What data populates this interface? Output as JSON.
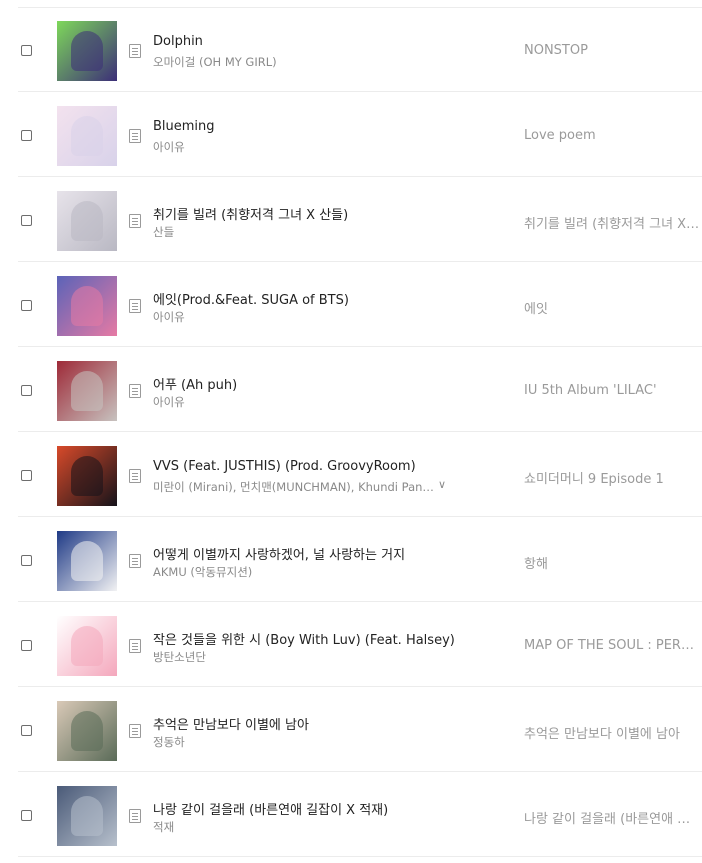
{
  "songs": [
    {
      "title": "Dolphin",
      "artist": "오마이걸 (OH MY GIRL)",
      "album": "NONSTOP",
      "cover_colors": [
        "#3c2e78",
        "#7ed85a"
      ],
      "cover_icon": "album-cover-image"
    },
    {
      "title": "Blueming",
      "artist": "아이유",
      "album": "Love poem",
      "cover_colors": [
        "#d8d2ea",
        "#f3e2ee"
      ],
      "cover_icon": "album-cover-image"
    },
    {
      "title": "취기를 빌려 (취향저격 그녀 X 산들)",
      "artist": "산들",
      "album": "취기를 빌려 (취향저격 그녀 X 산들)",
      "cover_colors": [
        "#b9b8c3",
        "#e7e3ea"
      ],
      "cover_icon": "album-cover-image"
    },
    {
      "title": "에잇(Prod.&Feat. SUGA of BTS)",
      "artist": "아이유",
      "album": "에잇",
      "cover_colors": [
        "#e67aa4",
        "#5b63b8"
      ],
      "cover_icon": "album-cover-image"
    },
    {
      "title": "어푸 (Ah puh)",
      "artist": "아이유",
      "album": "IU 5th Album 'LILAC'",
      "cover_colors": [
        "#c7c2bf",
        "#9e2a38"
      ],
      "cover_icon": "album-cover-image"
    },
    {
      "title": "VVS (Feat. JUSTHIS) (Prod. GroovyRoom)",
      "artist": "미란이 (Mirani), 먼치맨(MUNCHMAN), Khundi Panda, 머쉬베놈 (MUSHVENOM)",
      "album": "쇼미더머니 9 Episode 1",
      "cover_colors": [
        "#15131a",
        "#d84a2a"
      ],
      "cover_icon": "album-cover-image",
      "has_more_artists": true,
      "more_icon": "chevron-down-icon"
    },
    {
      "title": "어떻게 이별까지 사랑하겠어, 널 사랑하는 거지",
      "artist": "AKMU (악동뮤지션)",
      "album": "항해",
      "cover_colors": [
        "#f2f2f3",
        "#1f3a86"
      ],
      "cover_icon": "album-cover-image"
    },
    {
      "title": "작은 것들을 위한 시 (Boy With Luv) (Feat. Halsey)",
      "artist": "방탄소년단",
      "album": "MAP OF THE SOUL : PERSONA",
      "cover_colors": [
        "#f4a7bc",
        "#ffffff"
      ],
      "cover_icon": "album-cover-image"
    },
    {
      "title": "추억은 만남보다 이별에 남아",
      "artist": "정동하",
      "album": "추억은 만남보다 이별에 남아",
      "cover_colors": [
        "#5a6b58",
        "#d9c9b7"
      ],
      "cover_icon": "album-cover-image"
    },
    {
      "title": "나랑 같이 걸을래 (바른연애 길잡이 X 적재)",
      "artist": "적재",
      "album": "나랑 같이 걸을래 (바른연애 길잡이 X 적재)",
      "cover_colors": [
        "#b7c0cc",
        "#4a5a78"
      ],
      "cover_icon": "album-cover-image"
    }
  ],
  "icons": {
    "checkbox": "checkbox-icon",
    "lyrics": "lyrics-document-icon"
  }
}
